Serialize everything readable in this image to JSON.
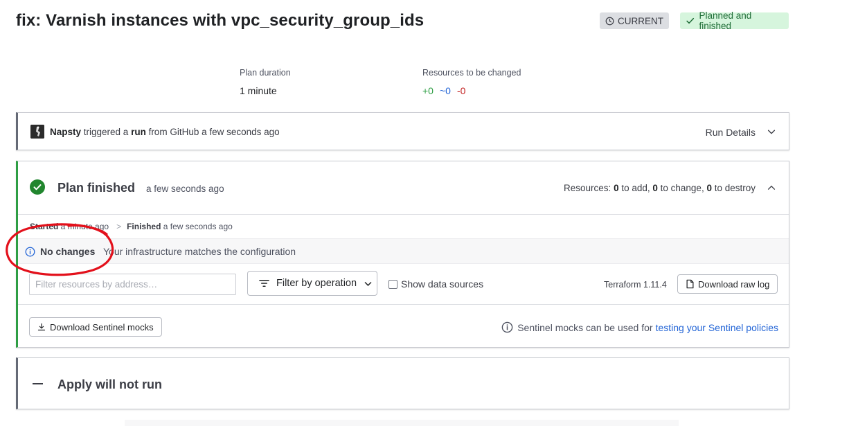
{
  "header": {
    "title": "fix: Varnish instances with vpc_security_group_ids",
    "badge_current": "CURRENT",
    "badge_status": "Planned and finished"
  },
  "stats": {
    "plan_duration_label": "Plan duration",
    "plan_duration_value": "1 minute",
    "resources_label": "Resources to be changed",
    "add": "+0",
    "change": "~0",
    "destroy": "-0"
  },
  "trigger": {
    "user": "Napsty",
    "text_triggered": " triggered a ",
    "run_word": "run",
    "text_rest": " from GitHub a few seconds ago",
    "run_details": "Run Details"
  },
  "plan": {
    "title": "Plan finished",
    "time": "a few seconds ago",
    "resources_prefix": "Resources: ",
    "add_count": "0",
    "add_text": " to add, ",
    "change_count": "0",
    "change_text": " to change, ",
    "destroy_count": "0",
    "destroy_text": " to destroy",
    "started_label": "Started",
    "started_time": " a minute ago",
    "separator": ">",
    "finished_label": "Finished",
    "finished_time": " a few seconds ago",
    "nochanges_title": "No changes",
    "nochanges_desc": "Your infrastructure matches the configuration",
    "filter_placeholder": "Filter resources by address…",
    "filter_button": "Filter by operation",
    "show_data_sources": "Show data sources",
    "terraform_version": "Terraform 1.11.4",
    "download_raw_log": "Download raw log",
    "download_mocks": "Download Sentinel mocks",
    "mocks_note": "Sentinel mocks can be used for",
    "mocks_link": "testing your Sentinel policies"
  },
  "apply": {
    "title": "Apply will not run"
  },
  "colors": {
    "success": "#2e9e44",
    "link": "#2264d6",
    "destroy": "#c21f1f",
    "annotation": "#e3101b"
  }
}
